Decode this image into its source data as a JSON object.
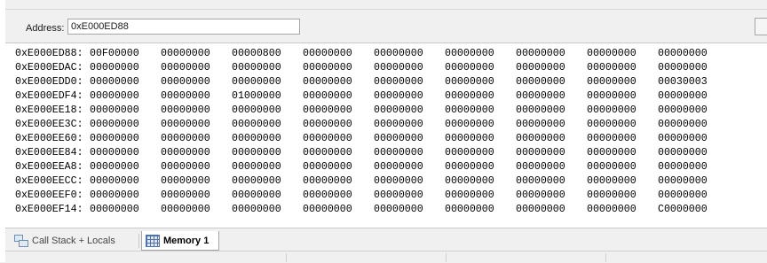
{
  "toolbar": {
    "address_label": "Address:",
    "address_value": "0xE000ED88"
  },
  "memory": {
    "rows": [
      {
        "addr": "0xE000ED88:",
        "words": [
          "00F00000",
          "00000000",
          "00000800",
          "00000000",
          "00000000",
          "00000000",
          "00000000",
          "00000000",
          "00000000"
        ]
      },
      {
        "addr": "0xE000EDAC:",
        "words": [
          "00000000",
          "00000000",
          "00000000",
          "00000000",
          "00000000",
          "00000000",
          "00000000",
          "00000000",
          "00000000"
        ]
      },
      {
        "addr": "0xE000EDD0:",
        "words": [
          "00000000",
          "00000000",
          "00000000",
          "00000000",
          "00000000",
          "00000000",
          "00000000",
          "00000000",
          "00030003"
        ]
      },
      {
        "addr": "0xE000EDF4:",
        "words": [
          "00000000",
          "00000000",
          "01000000",
          "00000000",
          "00000000",
          "00000000",
          "00000000",
          "00000000",
          "00000000"
        ]
      },
      {
        "addr": "0xE000EE18:",
        "words": [
          "00000000",
          "00000000",
          "00000000",
          "00000000",
          "00000000",
          "00000000",
          "00000000",
          "00000000",
          "00000000"
        ]
      },
      {
        "addr": "0xE000EE3C:",
        "words": [
          "00000000",
          "00000000",
          "00000000",
          "00000000",
          "00000000",
          "00000000",
          "00000000",
          "00000000",
          "00000000"
        ]
      },
      {
        "addr": "0xE000EE60:",
        "words": [
          "00000000",
          "00000000",
          "00000000",
          "00000000",
          "00000000",
          "00000000",
          "00000000",
          "00000000",
          "00000000"
        ]
      },
      {
        "addr": "0xE000EE84:",
        "words": [
          "00000000",
          "00000000",
          "00000000",
          "00000000",
          "00000000",
          "00000000",
          "00000000",
          "00000000",
          "00000000"
        ]
      },
      {
        "addr": "0xE000EEA8:",
        "words": [
          "00000000",
          "00000000",
          "00000000",
          "00000000",
          "00000000",
          "00000000",
          "00000000",
          "00000000",
          "00000000"
        ]
      },
      {
        "addr": "0xE000EECC:",
        "words": [
          "00000000",
          "00000000",
          "00000000",
          "00000000",
          "00000000",
          "00000000",
          "00000000",
          "00000000",
          "00000000"
        ]
      },
      {
        "addr": "0xE000EEF0:",
        "words": [
          "00000000",
          "00000000",
          "00000000",
          "00000000",
          "00000000",
          "00000000",
          "00000000",
          "00000000",
          "00000000"
        ]
      },
      {
        "addr": "0xE000EF14:",
        "words": [
          "00000000",
          "00000000",
          "00000000",
          "00000000",
          "00000000",
          "00000000",
          "00000000",
          "00000000",
          "C0000000"
        ]
      }
    ]
  },
  "tabs": [
    {
      "label": "Call Stack + Locals",
      "icon": "call-stack-icon",
      "active": false
    },
    {
      "label": "Memory 1",
      "icon": "memory-grid-icon",
      "active": true
    }
  ]
}
